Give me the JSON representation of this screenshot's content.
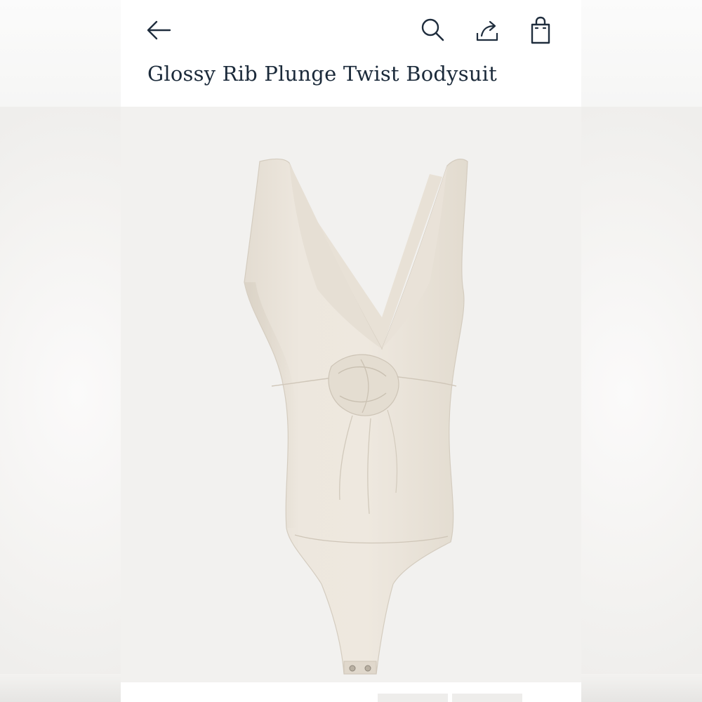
{
  "header": {
    "back_icon": "arrow-left-icon",
    "search_icon": "search-icon",
    "share_icon": "share-icon",
    "bag_icon": "shopping-bag-icon"
  },
  "product": {
    "title": "Glossy Rib Plunge Twist Bodysuit",
    "image_alt": "Cream sleeveless plunge twist bodysuit with snap closure",
    "garment_color": "#ece6dd"
  },
  "colors": {
    "title_text": "#1b2a3a",
    "icon": "#1f2d3d",
    "image_bg": "#f2f1ef"
  }
}
